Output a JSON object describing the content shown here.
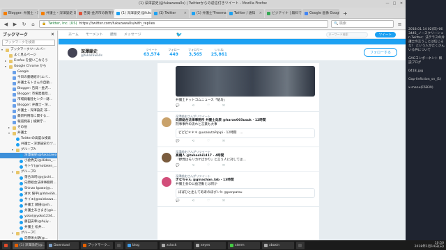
{
  "window": {
    "title": "(1) 深澤諭史(@fukazawa0s) | Twitterからの返信付きツイート - Mozilla Firefox"
  },
  "tabs": [
    {
      "label": "Blogger: 弁護士・深澤諭史の..",
      "color": "#f57d00"
    },
    {
      "label": "弁護士・深澤諭史 非ブロ..",
      "color": "#f57d00"
    },
    {
      "label": "告発-金沢市の教育行政を..",
      "color": "#e0533a"
    },
    {
      "label": "(1) 深澤諭史(@fukazawa...",
      "color": "#1da1f2",
      "active": true
    },
    {
      "label": "(1) Twitter",
      "color": "#1da1f2"
    },
    {
      "label": "(1) 弁護士\"Freeman\"Ha...",
      "color": "#1da1f2"
    },
    {
      "label": "Twitter / 通知",
      "color": "#1da1f2"
    },
    {
      "label": "ビジテイナ | 無料で使...",
      "color": "#34a853"
    },
    {
      "label": "Google 画像 Google 画像検",
      "color": "#4285f4"
    }
  ],
  "nav": {
    "url": "https://twitter.com/fukazawa0s/with_replies",
    "identity": "Twitter, Inc. (US)",
    "search_placeholder": "検索"
  },
  "sidebar": {
    "title": "ブックマーク",
    "close": "×",
    "search_placeholder": "ブックマークを検索",
    "items": [
      {
        "label": "ブックマークツールバー",
        "depth": 0,
        "arrow": "▾",
        "icon": "folder"
      },
      {
        "label": "よく見るページ",
        "depth": 1,
        "arrow": "",
        "icon": "folder"
      },
      {
        "label": "Firefox を使いこなそう",
        "depth": 1,
        "arrow": "▸",
        "icon": "folder"
      },
      {
        "label": "Google Chrome から",
        "depth": 1,
        "arrow": "▾",
        "icon": "folder"
      },
      {
        "label": "Google",
        "depth": 2,
        "arrow": "",
        "icon": "bm"
      },
      {
        "label": "今日の書籍紹介(エバ...",
        "depth": 2,
        "arrow": "",
        "icon": "bm"
      },
      {
        "label": "弁護士モトさんの自動...",
        "depth": 2,
        "arrow": "",
        "icon": "bm"
      },
      {
        "label": "Blogger: 告発・金沢...",
        "depth": 2,
        "arrow": "",
        "icon": "bm"
      },
      {
        "label": "Blogger: 市場発着陸...",
        "depth": 2,
        "arrow": "",
        "icon": "bm"
      },
      {
        "label": "市場発着陸センター跡...",
        "depth": 2,
        "arrow": "",
        "icon": "bm"
      },
      {
        "label": "Blogger: 弁護士・深...",
        "depth": 2,
        "arrow": "",
        "icon": "bm"
      },
      {
        "label": "弁護士・深澤諭史 非...",
        "depth": 2,
        "arrow": "",
        "icon": "bm"
      },
      {
        "label": "最新判例等に関する...",
        "depth": 2,
        "arrow": "",
        "icon": "bm"
      },
      {
        "label": "報道発表 | 検察庁...",
        "depth": 2,
        "arrow": "",
        "icon": "bm"
      },
      {
        "label": "その他",
        "depth": 2,
        "arrow": "▸",
        "icon": "folder"
      },
      {
        "label": "弁護士",
        "depth": 2,
        "arrow": "▾",
        "icon": "folder"
      },
      {
        "label": "Twitterの高度な検索",
        "depth": 3,
        "arrow": "",
        "icon": "tw"
      },
      {
        "label": "弁護士・深澤諭史のツ...",
        "depth": 3,
        "arrow": "",
        "icon": "tw"
      },
      {
        "label": "グループA",
        "depth": 3,
        "arrow": "▾",
        "icon": "folder"
      },
      {
        "label": "深澤諭史(@fukazawa...",
        "depth": 4,
        "arrow": "",
        "icon": "tw",
        "selected": true
      },
      {
        "label": "小倉秀夫(@Hideo_...",
        "depth": 4,
        "arrow": "",
        "icon": "tw"
      },
      {
        "label": "モトケ(@motoken_...",
        "depth": 4,
        "arrow": "",
        "icon": "tw"
      },
      {
        "label": "グループB",
        "depth": 3,
        "arrow": "▾",
        "icon": "folder"
      },
      {
        "label": "落合洋司(@yjochi...",
        "depth": 4,
        "arrow": "",
        "icon": "tw"
      },
      {
        "label": "向原総合法律事務所...",
        "depth": 4,
        "arrow": "",
        "icon": "tw"
      },
      {
        "label": "Shinzo Igawa(@...",
        "depth": 4,
        "arrow": "",
        "icon": "tw"
      },
      {
        "label": "清水 陽平(@YoheiSh...",
        "depth": 4,
        "arrow": "",
        "icon": "tw"
      },
      {
        "label": "サイエ(@saiekawa...",
        "depth": 4,
        "arrow": "",
        "icon": "tw"
      },
      {
        "label": "弁護士 藤田(@sh...",
        "depth": 4,
        "arrow": "",
        "icon": "tw"
      },
      {
        "label": "弁護士あさまさ(@k...",
        "depth": 4,
        "arrow": "",
        "icon": "tw"
      },
      {
        "label": "yoko(@yoko1234...",
        "depth": 4,
        "arrow": "",
        "icon": "tw"
      },
      {
        "label": "藤田安幸(@fujiy...",
        "depth": 4,
        "arrow": "",
        "icon": "tw"
      },
      {
        "label": "弁護士 松井...",
        "depth": 4,
        "arrow": "",
        "icon": "tw"
      },
      {
        "label": "グループC",
        "depth": 3,
        "arrow": "▾",
        "icon": "folder"
      },
      {
        "label": "向原栄大朗(@...",
        "depth": 4,
        "arrow": "",
        "icon": "tw"
      }
    ]
  },
  "twitter": {
    "header_links": [
      "ホーム",
      "モーメント",
      "通知",
      "メッセージ"
    ],
    "search_placeholder": "キーワード検索",
    "tweet_button": "ツイート",
    "profile": {
      "name": "深澤諭史",
      "handle": "@fukazawa0s",
      "follow_label": "フォローする"
    },
    "stats": [
      {
        "label": "ツイート",
        "value": "63,574"
      },
      {
        "label": "フォロー",
        "value": "449"
      },
      {
        "label": "フォロワー",
        "value": "3,565"
      },
      {
        "label": "いいね",
        "value": "25,861"
      }
    ],
    "tweets": [
      {
        "has_photo": true,
        "meta": "",
        "name": "",
        "text": "弁護士ドットコムニュース「給与」",
        "quote": "",
        "avatar_color": "#888"
      },
      {
        "has_photo": false,
        "meta": "深澤諭史さんがリツイート",
        "name": "向原総合法律事務所 弁護士向原 @harao003usuk · 12時間",
        "text": "刑事事件の流れと言葉も大事",
        "quote": "ピピピ＊＊＊ @usakutaPipipi · 12時間　…",
        "avatar_color": "#c9a26b"
      },
      {
        "has_photo": false,
        "meta": "深澤諭史さんがリツイート",
        "name": "高橋人 @tahashi1417 · 4時間",
        "text": "「野党はモリカケばかり」と言う人に対しては…",
        "quote": "",
        "avatar_color": "#7a5c3e"
      },
      {
        "has_photo": false,
        "meta": "深澤諭史さんがリツイート",
        "name": "ぎなちゃん @ginachan_lab · 13時間",
        "text": "弁護士会の公益活動とは何か",
        "quote": "ぼぼひと出して寿寿のぼびンヒ @ponpatsu",
        "avatar_color": "#d24e7a"
      }
    ]
  },
  "desktop_notes": [
    "2018.01.14 02(日)-063445_ノースクリーン on Twitter：法テラスの弁護士の言うことは信じるな！ という人がたくさんいる件について",
    "GAGコンポーネント 解説ブログ",
    "0418_jpg",
    "Gap-linfiction_sn_(1)",
    "x-manu(F6B39)"
  ],
  "taskbar": {
    "items": [
      {
        "label": "",
        "color": "#e04b2a"
      },
      {
        "label": "(1) 深澤諭史(@...",
        "color": "#e66000",
        "active": true
      },
      {
        "label": "Download",
        "color": "#7da0c8"
      },
      {
        "label": "ブックマーク...",
        "color": "#e66000"
      },
      {
        "label": "",
        "color": "#555"
      },
      {
        "label": "blog",
        "color": "#3d9be9"
      },
      {
        "label": "xclock",
        "color": "#aaa"
      },
      {
        "label": "xeyes",
        "color": "#aaa"
      },
      {
        "label": "xterm",
        "color": "#4c4"
      },
      {
        "label": "xboxin",
        "color": "#aaa"
      },
      {
        "label": "",
        "color": "#555"
      }
    ],
    "time": "10:50",
    "date": "2018年1月14日(日)"
  }
}
